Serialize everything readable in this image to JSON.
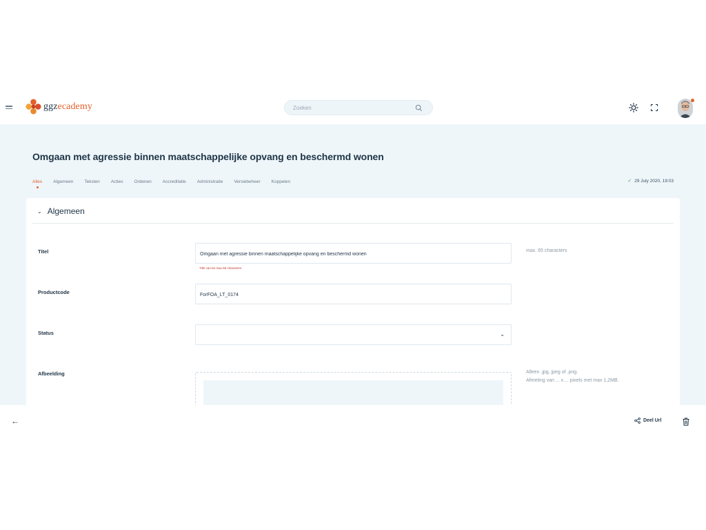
{
  "header": {
    "logo_prefix": "ggz",
    "logo_suffix": "ecademy",
    "search_placeholder": "Zoeken"
  },
  "page": {
    "title": "Omgaan met agressie binnen maatschappelijke opvang en beschermd wonen",
    "saved_status": "29 July 2020, 19:03"
  },
  "tabs": [
    {
      "label": "Alles",
      "active": true
    },
    {
      "label": "Algemeen"
    },
    {
      "label": "Teksten"
    },
    {
      "label": "Acties"
    },
    {
      "label": "Ordenen"
    },
    {
      "label": "Accreditatie"
    },
    {
      "label": "Administratie"
    },
    {
      "label": "Versiebeheer"
    },
    {
      "label": "Koppelen"
    }
  ],
  "section": {
    "title": "Algemeen"
  },
  "form": {
    "titel_label": "Titel",
    "titel_value": "Omgaan met agressie binnen maatschappelijke opvang en beschermd wonen",
    "titel_error": "Title can be max 65 characters",
    "titel_hint": "max. 65 characters",
    "productcode_label": "Productcode",
    "productcode_value": "ForFOA_LT_0174",
    "status_label": "Status",
    "status_value": "",
    "afbeelding_label": "Afbeelding",
    "afbeelding_hint_1": "Alleen .jpg, jpeg of .png.",
    "afbeelding_hint_2": "Afmeting van ... x ... pixels met max 1,2MB."
  },
  "footer": {
    "share_label": "Deel Url"
  },
  "colors": {
    "accent": "#e4602a",
    "text_dark": "#1f3446",
    "background": "#eef6fa",
    "error": "#c0392b",
    "success": "#2aa06a"
  }
}
